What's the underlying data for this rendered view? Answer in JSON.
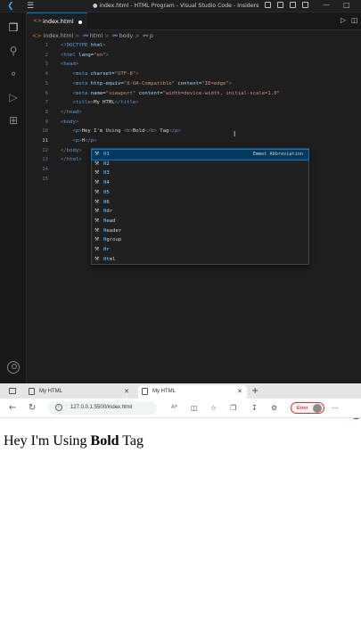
{
  "vscode": {
    "window_title": "● index.html - HTML Program - Visual Studio Code - Insiders",
    "menu_icon": "hamburger-icon",
    "active_tab": {
      "label": "index.html",
      "icon": "html-file-icon",
      "modified": true
    },
    "breadcrumb": [
      "index.html",
      "html",
      "body",
      "p"
    ],
    "lines": [
      {
        "n": "1",
        "html": "<span class=\"t-ang\">&lt;</span><span class=\"t-tag\">!DOCTYPE</span> <span class=\"t-attr\">html</span><span class=\"t-ang\">&gt;</span>"
      },
      {
        "n": "2",
        "html": "<span class=\"t-ang\">&lt;</span><span class=\"t-tag\">html</span> <span class=\"t-attr\">lang</span>=<span class=\"t-val\">\"en\"</span><span class=\"t-ang\">&gt;</span>"
      },
      {
        "n": "3",
        "html": "<span class=\"t-ang\">&lt;</span><span class=\"t-tag\">head</span><span class=\"t-ang\">&gt;</span>"
      },
      {
        "n": "4",
        "html": "    <span class=\"t-ang\">&lt;</span><span class=\"t-tag\">meta</span> <span class=\"t-attr\">charset</span>=<span class=\"t-val\">\"UTF-8\"</span><span class=\"t-ang\">&gt;</span>"
      },
      {
        "n": "5",
        "html": "    <span class=\"t-ang\">&lt;</span><span class=\"t-tag\">meta</span> <span class=\"t-attr\">http-equiv</span>=<span class=\"t-val\">\"X-UA-Compatible\"</span> <span class=\"t-attr\">content</span>=<span class=\"t-val\">\"IE=edge\"</span><span class=\"t-ang\">&gt;</span>"
      },
      {
        "n": "6",
        "html": "    <span class=\"t-ang\">&lt;</span><span class=\"t-tag\">meta</span> <span class=\"t-attr\">name</span>=<span class=\"t-val\">\"viewport\"</span> <span class=\"t-attr\">content</span>=<span class=\"t-val\">\"width=device-width, initial-scale=1.0\"</span>"
      },
      {
        "n": "7",
        "html": "    <span class=\"t-ang\">&lt;</span><span class=\"t-tag\">title</span><span class=\"t-ang\">&gt;</span><span class=\"t-txt\">My HTML</span><span class=\"t-ang\">&lt;/</span><span class=\"t-tag\">title</span><span class=\"t-ang\">&gt;</span>"
      },
      {
        "n": "8",
        "html": "<span class=\"t-ang\">&lt;/</span><span class=\"t-tag\">head</span><span class=\"t-ang\">&gt;</span>"
      },
      {
        "n": "9",
        "html": "<span class=\"t-ang\">&lt;</span><span class=\"t-tag\">body</span><span class=\"t-ang\">&gt;</span>"
      },
      {
        "n": "10",
        "html": "    <span class=\"t-ang\">&lt;</span><span class=\"t-tag\">p</span><span class=\"t-ang\">&gt;</span><span class=\"t-txt\">Hey I'm Using </span><span class=\"t-ang\">&lt;</span><span class=\"t-tag\">b</span><span class=\"t-ang\">&gt;</span><span class=\"t-txt\">Bold</span><span class=\"t-ang\">&lt;/</span><span class=\"t-tag\">b</span><span class=\"t-ang\">&gt;</span><span class=\"t-txt\"> Tag</span><span class=\"t-ang\">&lt;/</span><span class=\"t-tag\">p</span><span class=\"t-ang\">&gt;</span>"
      },
      {
        "n": "11",
        "html": "    <span class=\"t-ang\">&lt;</span><span class=\"t-tag\">p</span><span class=\"t-ang\">&gt;</span><span class=\"t-txt\">H</span><span class=\"t-ang\">&lt;/</span><span class=\"t-tag\">p</span><span class=\"t-ang\">&gt;</span>",
        "active": true
      },
      {
        "n": "12",
        "html": "<span class=\"t-ang\">&lt;/</span><span class=\"t-tag\">body</span><span class=\"t-ang\">&gt;</span>"
      },
      {
        "n": "13",
        "html": "<span class=\"t-ang\">&lt;/</span><span class=\"t-tag\">html</span><span class=\"t-ang\">&gt;</span>"
      },
      {
        "n": "14",
        "html": ""
      },
      {
        "n": "15",
        "html": ""
      }
    ],
    "suggestions": [
      {
        "label": "H1",
        "detail": "Emmet Abbreviation",
        "selected": true
      },
      {
        "label": "H2"
      },
      {
        "label": "H3"
      },
      {
        "label": "H4"
      },
      {
        "label": "H5"
      },
      {
        "label": "H6"
      },
      {
        "label": "Hdr"
      },
      {
        "label": "Head"
      },
      {
        "label": "Header"
      },
      {
        "label": "Hgroup"
      },
      {
        "label": "Hr"
      },
      {
        "label": "Html"
      }
    ],
    "suggestion_icon": "wrench-icon"
  },
  "browser": {
    "tabs": [
      {
        "label": "My HTML"
      },
      {
        "label": "My HTML"
      }
    ],
    "url": "127.0.0.1:5500/index.html",
    "error_label": "Error",
    "page": {
      "before": "Hey I'm Using ",
      "bold": "Bold",
      "after": " Tag"
    }
  }
}
